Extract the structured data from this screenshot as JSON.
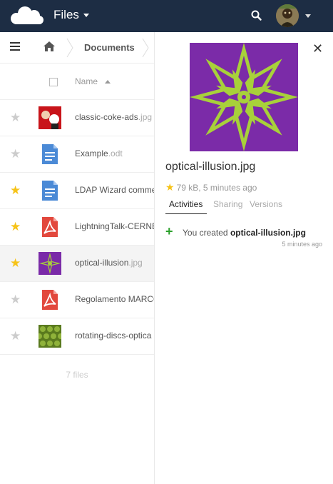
{
  "header": {
    "app_name": "Files",
    "logo_icon": "owncloud-logo-icon",
    "search_icon": "search-icon",
    "colors": {
      "bar": "#1d2d44"
    }
  },
  "breadcrumb": {
    "current": "Documents"
  },
  "table": {
    "column_name": "Name",
    "rows": [
      {
        "base": "classic-coke-ads",
        "ext": ".jpg",
        "favorite": false,
        "type": "image-red"
      },
      {
        "base": "Example",
        "ext": ".odt",
        "favorite": false,
        "type": "document"
      },
      {
        "base": "LDAP Wizard comme",
        "ext": "",
        "favorite": true,
        "type": "document"
      },
      {
        "base": "LightningTalk-CERNB",
        "ext": "",
        "favorite": true,
        "type": "pdf"
      },
      {
        "base": "optical-illusion",
        "ext": ".jpg",
        "favorite": true,
        "type": "image-illusion"
      },
      {
        "base": "Regolamento MARCO",
        "ext": "",
        "favorite": false,
        "type": "pdf"
      },
      {
        "base": "rotating-discs-optica",
        "ext": "",
        "favorite": false,
        "type": "image-discs"
      }
    ],
    "summary": "7 files"
  },
  "sidebar": {
    "title": "optical-illusion.jpg",
    "meta": "79 kB, 5 minutes ago",
    "tabs": [
      "Activities",
      "Sharing",
      "Versions"
    ],
    "activity": {
      "prefix": "You created ",
      "file": "optical-illusion.jpg",
      "time": "5 minutes ago"
    }
  }
}
